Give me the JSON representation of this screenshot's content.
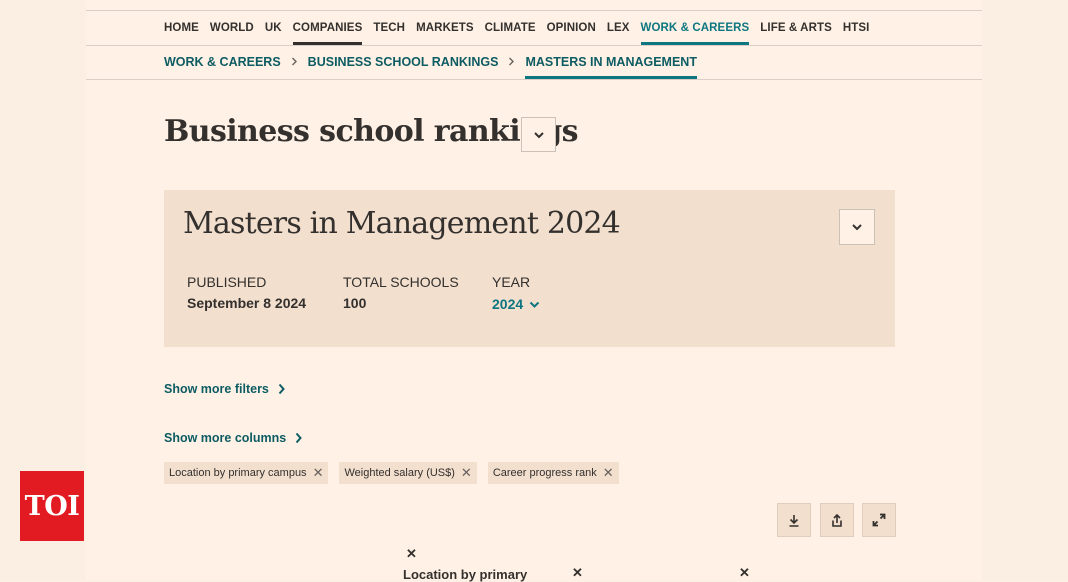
{
  "nav": {
    "items": [
      "HOME",
      "WORLD",
      "UK",
      "COMPANIES",
      "TECH",
      "MARKETS",
      "CLIMATE",
      "OPINION",
      "LEX",
      "WORK & CAREERS",
      "LIFE & ARTS",
      "HTSI"
    ]
  },
  "breadcrumb": {
    "items": [
      "WORK & CAREERS",
      "BUSINESS SCHOOL RANKINGS",
      "MASTERS IN MANAGEMENT"
    ],
    "separator": ">"
  },
  "page": {
    "title": "Business school rankings"
  },
  "ranking": {
    "title": "Masters in Management 2024",
    "published_label": "PUBLISHED",
    "published_value": "September 8 2024",
    "total_label": "TOTAL SCHOOLS",
    "total_value": "100",
    "year_label": "YEAR",
    "year_value": "2024"
  },
  "filters": {
    "show_more_filters": "Show more filters",
    "show_more_columns": "Show more columns",
    "chips": [
      "Location by primary campus",
      "Weighted salary (US$)",
      "Career progress rank"
    ],
    "chip_close": "✕"
  },
  "table": {
    "column_close": "✕",
    "first_column_header": "Location by primary"
  },
  "watermark": {
    "text": "TOI"
  },
  "colors": {
    "accent": "#0d7680",
    "background": "#fff1e5",
    "card": "#f2dfce",
    "toi_red": "#e21b22"
  }
}
